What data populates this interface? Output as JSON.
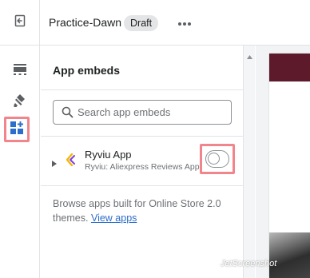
{
  "topbar": {
    "exit_icon": "exit-icon",
    "theme_name": "Practice-Dawn",
    "status_badge": "Draft",
    "more_icon": "more-horizontal-icon"
  },
  "rail": {
    "items": [
      {
        "name": "sections",
        "icon": "sections-icon",
        "active": false
      },
      {
        "name": "theme-settings",
        "icon": "paint-brush-icon",
        "active": false
      },
      {
        "name": "app-embeds",
        "icon": "app-embed-icon",
        "active": true
      }
    ]
  },
  "panel": {
    "title": "App embeds",
    "search": {
      "placeholder": "Search app embeds",
      "value": ""
    },
    "apps": [
      {
        "name": "Ryviu App",
        "subtitle": "Ryviu: Aliexpress Reviews App",
        "enabled": false,
        "logo_icon": "ryviu-logo-icon"
      }
    ],
    "browse_text": "Browse apps built for Online Store 2.0 themes.",
    "browse_link": "View apps"
  },
  "colors": {
    "accent_link": "#2c6ecb",
    "highlight": "#f2848b",
    "active_icon": "#2c6ecb",
    "preview_banner": "#5c1a2a"
  },
  "watermark": "JetScreenshot"
}
